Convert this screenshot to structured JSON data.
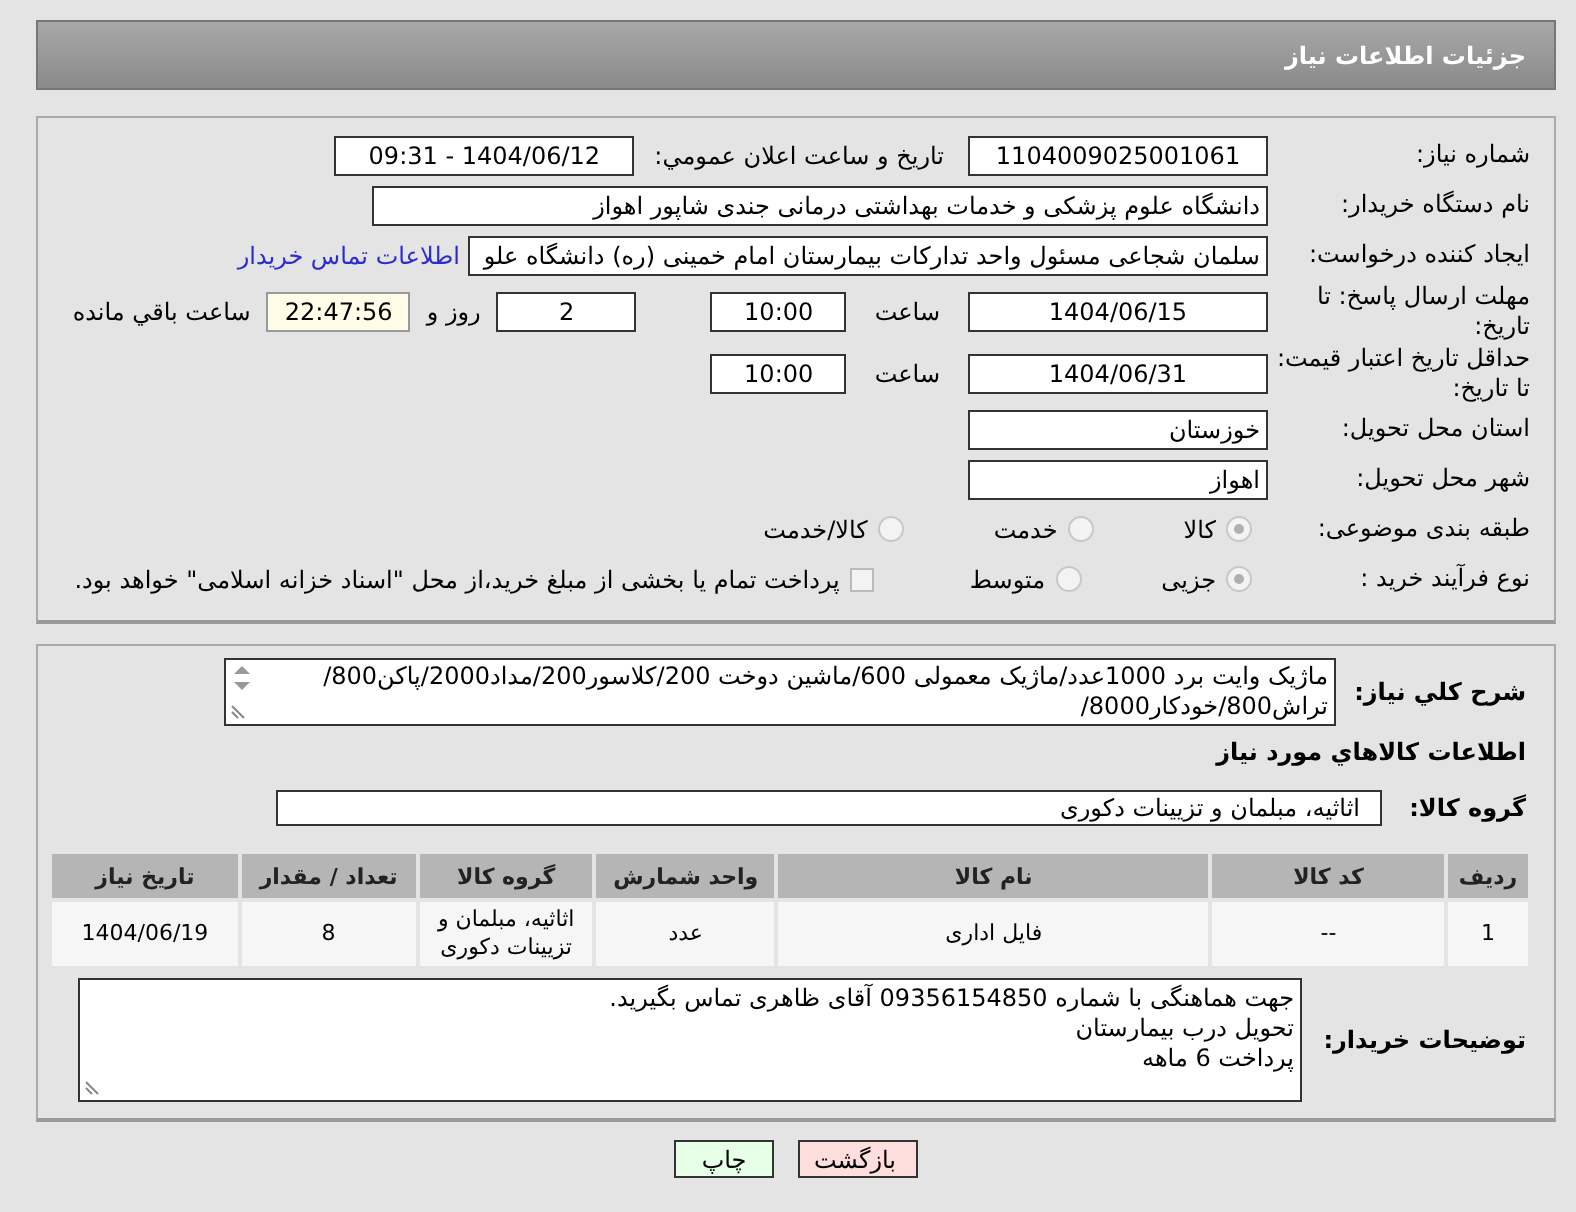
{
  "header": {
    "title": "جزئیات اطلاعات نیاز"
  },
  "need_number": {
    "label": "شماره نیاز:",
    "value": "1104009025001061"
  },
  "announce": {
    "label": "تاریخ و ساعت اعلان عمومي:",
    "value": "1404/06/12 - 09:31"
  },
  "buyer": {
    "label": "نام دستگاه خریدار:",
    "value": "دانشگاه علوم پزشکی و خدمات بهداشتی درمانی جندی شاپور اهواز"
  },
  "requester": {
    "label": "ایجاد کننده درخواست:",
    "value": "سلمان شجاعی مسئول واحد تدارکات بیمارستان امام خمینی (ره) دانشگاه علو",
    "link": "اطلاعات تماس خریدار"
  },
  "deadline": {
    "label": "مهلت ارسال پاسخ: تا تاریخ:",
    "date": "1404/06/15",
    "time_label": "ساعت",
    "time": "10:00",
    "days": "2",
    "days_label": "روز و",
    "remaining": "22:47:56",
    "remaining_label": "ساعت باقي مانده"
  },
  "price_validity": {
    "label": "حداقل تاریخ اعتبار قیمت: تا تاریخ:",
    "date": "1404/06/31",
    "time_label": "ساعت",
    "time": "10:00"
  },
  "province": {
    "label": "استان محل تحویل:",
    "value": "خوزستان"
  },
  "city": {
    "label": "شهر محل تحویل:",
    "value": "اهواز"
  },
  "category": {
    "label": "طبقه بندی موضوعی:",
    "options": [
      {
        "label": "کالا",
        "selected": true
      },
      {
        "label": "خدمت",
        "selected": false
      },
      {
        "label": "کالا/خدمت",
        "selected": false
      }
    ]
  },
  "purchase_type": {
    "label": "نوع فرآیند خرید :",
    "options": [
      {
        "label": "جزیی",
        "selected": true
      },
      {
        "label": "متوسط",
        "selected": false
      }
    ],
    "treasury": {
      "label": "پرداخت تمام یا بخشی از مبلغ خرید،از محل \"اسناد خزانه اسلامی\" خواهد بود.",
      "checked": false
    }
  },
  "description": {
    "label": "شرح کلي نياز:",
    "value": "ماژیک وایت برد 1000عدد/ماژیک معمولی 600/ماشین دوخت 200/کلاسور200/مداد2000/پاکن800/تراش800/خودکار8000/"
  },
  "goods_heading": "اطلاعات کالاهاي مورد نياز",
  "goods_group": {
    "label": "گروه کالا:",
    "value": "اثاثیه، مبلمان و تزیینات دکوری"
  },
  "table": {
    "columns": [
      "ردیف",
      "کد کالا",
      "نام کالا",
      "واحد شمارش",
      "گروه کالا",
      "تعداد / مقدار",
      "تاریخ نیاز"
    ],
    "rows": [
      [
        "1",
        "--",
        "فایل اداری",
        "عدد",
        "اثاثیه، مبلمان و تزیینات دکوری",
        "8",
        "1404/06/19"
      ]
    ]
  },
  "buyer_notes": {
    "label": "توضیحات خریدار:",
    "lines": [
      "جهت هماهنگی با شماره 09356154850 آقای ظاهری تماس بگیرید.",
      "تحویل درب بیمارستان",
      "پرداخت 6 ماهه"
    ]
  },
  "buttons": [
    {
      "label": "بازگشت",
      "kind": "back"
    },
    {
      "label": "چاپ",
      "kind": "print"
    }
  ]
}
